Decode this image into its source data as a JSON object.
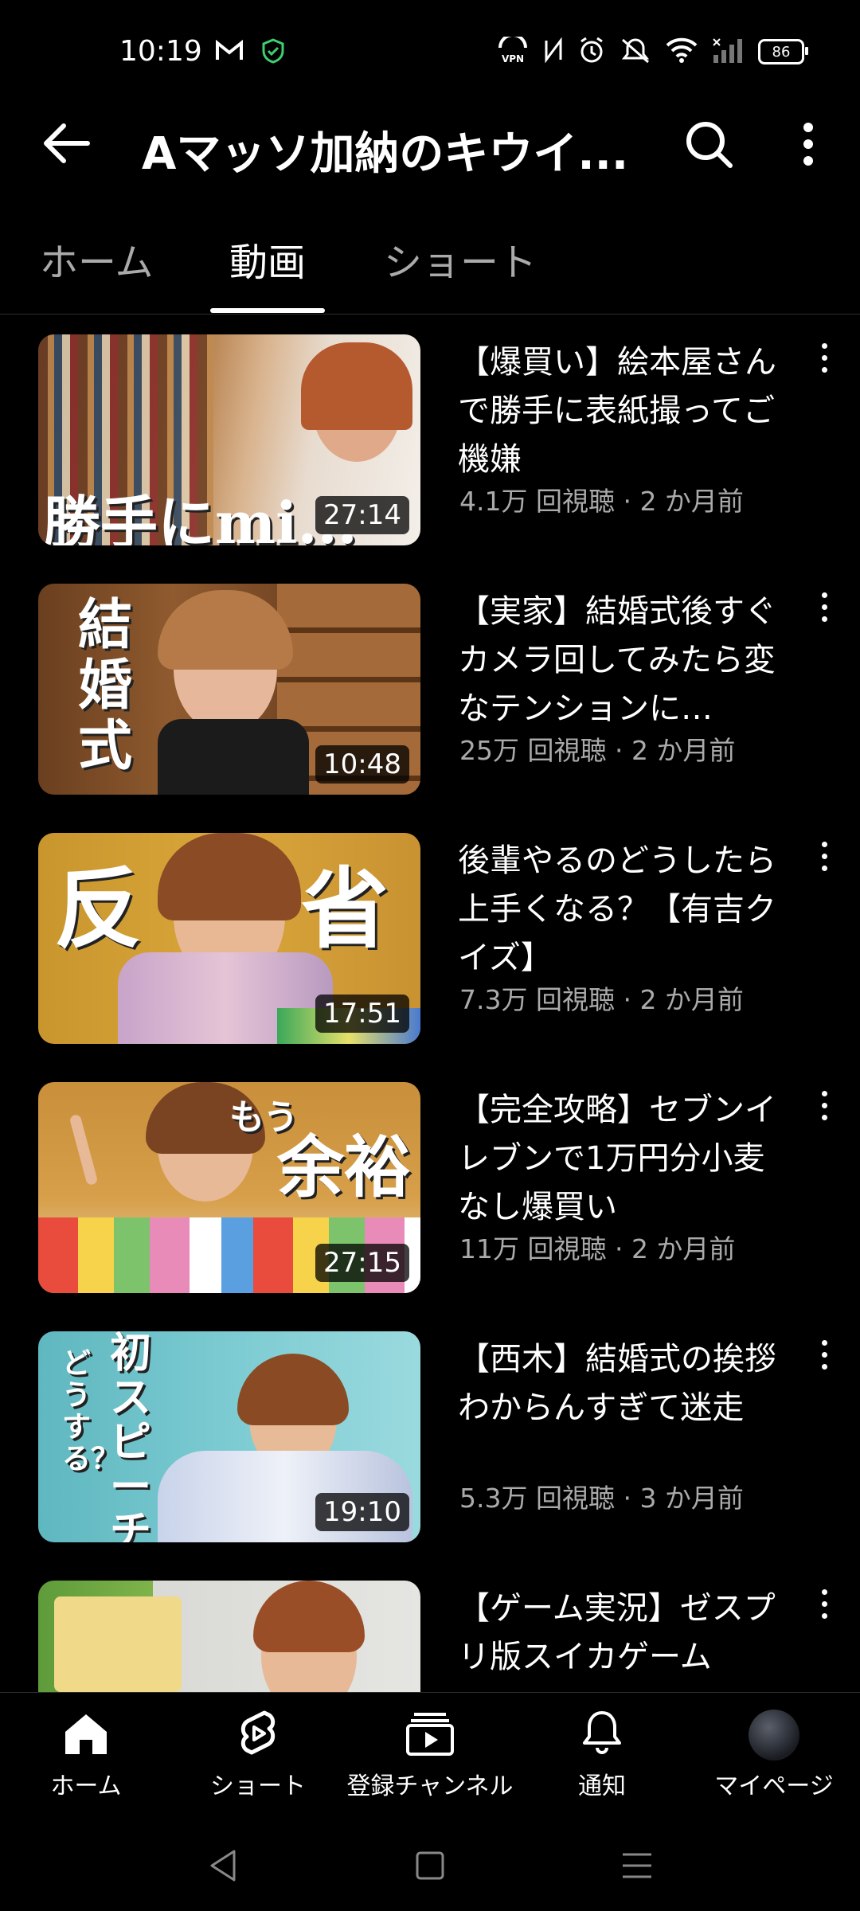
{
  "status_bar": {
    "time": "10:19",
    "battery": "86"
  },
  "header": {
    "title": "Aマッソ加納のキウイ..."
  },
  "tabs": [
    {
      "label": "ホーム",
      "active": false
    },
    {
      "label": "動画",
      "active": true
    },
    {
      "label": "ショート",
      "active": false
    }
  ],
  "videos": [
    {
      "title": "【爆買い】絵本屋さんで勝手に表紙撮ってご機嫌",
      "meta": "4.1万 回視聴 · 2 か月前",
      "duration": "27:14",
      "thumb_text": "勝手にmi..."
    },
    {
      "title": "【実家】結婚式後すぐカメラ回してみたら変なテンションに…",
      "meta": "25万 回視聴 · 2 か月前",
      "duration": "10:48",
      "thumb_text": "結婚式"
    },
    {
      "title": "後輩やるのどうしたら上手くなる？【有吉クイズ】",
      "meta": "7.3万 回視聴 · 2 か月前",
      "duration": "17:51",
      "thumb_text_left": "反",
      "thumb_text_right": "省"
    },
    {
      "title": "【完全攻略】セブンイレブンで1万円分小麦なし爆買い",
      "meta": "11万 回視聴 · 2 か月前",
      "duration": "27:15",
      "thumb_text_small": "もう",
      "thumb_text": "余裕"
    },
    {
      "title": "【西木】結婚式の挨拶わからんすぎて迷走",
      "meta": "5.3万 回視聴 · 3 か月前",
      "duration": "19:10",
      "thumb_text": "初スピーチ",
      "thumb_text_small": "どうする？"
    },
    {
      "title": "【ゲーム実況】ゼスプリ版スイカゲーム",
      "meta": "",
      "duration": ""
    }
  ],
  "bottom_nav": [
    {
      "label": "ホーム",
      "icon": "home-icon"
    },
    {
      "label": "ショート",
      "icon": "shorts-icon"
    },
    {
      "label": "登録チャンネル",
      "icon": "subscriptions-icon"
    },
    {
      "label": "通知",
      "icon": "bell-icon"
    },
    {
      "label": "マイページ",
      "icon": "avatar"
    }
  ]
}
